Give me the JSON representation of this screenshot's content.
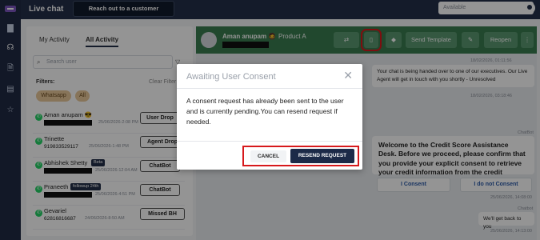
{
  "topbar": {
    "title": "Live chat",
    "reach_button": "Reach out to a customer",
    "status_value": "Available"
  },
  "sidebar": {
    "tabs": [
      "My Activity",
      "All Activity"
    ],
    "search_placeholder": "Search user",
    "filters_label": "Filters:",
    "clear_filter": "Clear Filter",
    "chips": [
      "Whatsapp",
      "All"
    ],
    "conversations": [
      {
        "name": "Aman anupam 😎",
        "phone": "",
        "date": "25/06/2026-2:08 PM",
        "action": "User Drop",
        "badge": ""
      },
      {
        "name": "Trinette",
        "phone": "919833529117",
        "date": "25/06/2026-1:48 PM",
        "action": "Agent Drop",
        "badge": ""
      },
      {
        "name": "Abhishek Shetty",
        "phone": "",
        "date": "25/06/2026-12:04 AM",
        "action": "ChatBot",
        "badge": "Beta"
      },
      {
        "name": "Praneeth",
        "phone": "",
        "date": "25/06/2026-4:51 PM",
        "action": "ChatBot",
        "badge": "followup 24th"
      },
      {
        "name": "Gevariel",
        "phone": "62816816687",
        "date": "24/06/2026-8:50 AM",
        "action": "Missed BH",
        "badge": ""
      }
    ]
  },
  "chat": {
    "contact_name": "Aman anupam 🧔",
    "product": "Product A",
    "send_template": "Send Template",
    "reopen": "Reopen",
    "messages": {
      "t1": "18/02/2026, 01:11:56",
      "handover": "Your chat is being handed over to one of our executives. Our Live Agent will get in touch with you shortly - Unresolved",
      "t2": "18/02/2026, 03:18:46",
      "sender1": "ChatBot",
      "welcome": "Welcome to the Credit Score Assistance Desk. Before we proceed, please confirm that you provide your explicit consent to retrieve your credit information from the credit bureau.",
      "consent_yes": "I Consent",
      "consent_no": "I do not Consent",
      "t3": "25/06/2026, 14:08:00",
      "sender2": "Chatbot",
      "reply": "We'll get back to you",
      "t4": "25/06/2026, 14:13:00"
    }
  },
  "modal": {
    "title": "Awaiting User Consent",
    "body": "A consent request has already been sent to the user and is currently pending.You can resend request if needed.",
    "cancel": "CANCEL",
    "resend": "RESEND REQUEST"
  },
  "colors": {
    "header_green": "#3a7d50",
    "navy": "#1c2a48",
    "highlight_red": "#d7191c",
    "chip": "#e9c89a"
  }
}
